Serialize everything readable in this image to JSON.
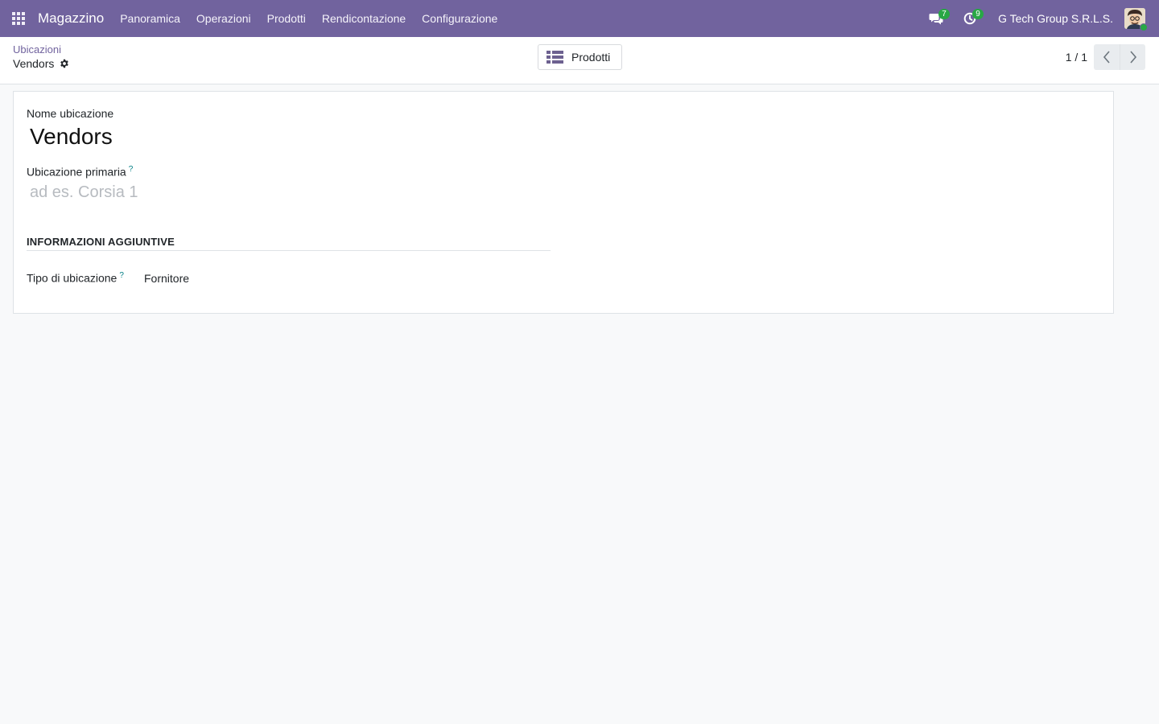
{
  "navbar": {
    "app_name": "Magazzino",
    "menu": [
      {
        "label": "Panoramica"
      },
      {
        "label": "Operazioni"
      },
      {
        "label": "Prodotti"
      },
      {
        "label": "Rendicontazione"
      },
      {
        "label": "Configurazione"
      }
    ],
    "messages_count": "7",
    "activities_count": "9",
    "company": "G Tech Group S.R.L.S.",
    "colors": {
      "navbar_bg": "#71639e",
      "badge": "#28a745"
    },
    "icons": [
      "apps-grid-icon",
      "chat-icon",
      "clock-icon",
      "user-avatar"
    ]
  },
  "control_panel": {
    "breadcrumb_parent": "Ubicazioni",
    "breadcrumb_current": "Vendors",
    "smart_button_label": "Prodotti",
    "pager": "1 / 1"
  },
  "form": {
    "name_label": "Nome ubicazione",
    "name_value": "Vendors",
    "parent_label": "Ubicazione primaria",
    "parent_help": "?",
    "parent_placeholder": "ad es. Corsia 1",
    "section_title": "INFORMAZIONI AGGIUNTIVE",
    "type_label": "Tipo di ubicazione",
    "type_help": "?",
    "type_value": "Fornitore"
  }
}
